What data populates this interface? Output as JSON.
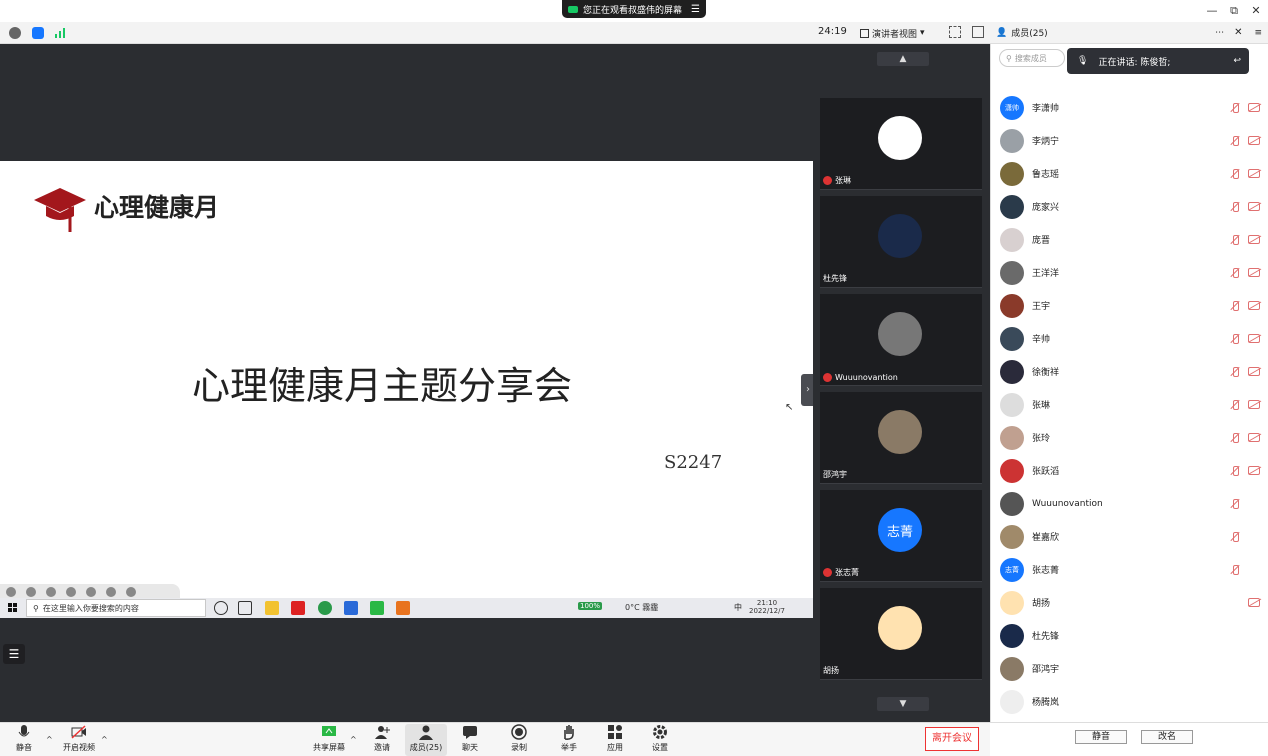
{
  "share_banner": {
    "text": "您正在观看叔盛伟的屏幕",
    "menu_icon": "menu-icon"
  },
  "window": {
    "min": "—",
    "restore": "⧉",
    "close": "✕"
  },
  "toolbar": {
    "timer": "24:19",
    "view_mode": "演讲者视图"
  },
  "slide": {
    "brand": "心理健康月",
    "title": "心理健康月主题分享会",
    "code": "S2247"
  },
  "taskbar": {
    "search_placeholder": "在这里输入你要搜索的内容",
    "battery": "100%",
    "weather": "0°C 霧霾",
    "ime": "中",
    "time": "21:10",
    "date": "2022/12/7"
  },
  "video_tiles": [
    {
      "name": "张琳",
      "avatar_bg": "#ffffff",
      "avatar_text": ""
    },
    {
      "name": "杜先锋",
      "avatar_bg": "#1a2a4a",
      "avatar_text": ""
    },
    {
      "name": "Wuuunovantion",
      "avatar_bg": "#777777",
      "avatar_text": ""
    },
    {
      "name": "邵鸿宇",
      "avatar_bg": "#8a7a66",
      "avatar_text": ""
    },
    {
      "name": "张志菁",
      "avatar_bg": "#1677ff",
      "avatar_text": "志菁"
    },
    {
      "name": "胡扬",
      "avatar_bg": "#ffe2b0",
      "avatar_text": ""
    }
  ],
  "panel": {
    "title": "成员(25)",
    "search_placeholder": "搜索成员",
    "talking": "正在讲话: 陈俊哲;",
    "participants": [
      {
        "name": "李潇帅",
        "bg": "#1677ff",
        "text": "潇帅",
        "mic_off": true,
        "cam_off": true
      },
      {
        "name": "李炳宁",
        "bg": "#9aa0a6",
        "text": "",
        "mic_off": true,
        "cam_off": true
      },
      {
        "name": "鲁志瑶",
        "bg": "#7a6a3a",
        "text": "",
        "mic_off": true,
        "cam_off": true
      },
      {
        "name": "庞家兴",
        "bg": "#2a3a4a",
        "text": "",
        "mic_off": true,
        "cam_off": true
      },
      {
        "name": "庞晋",
        "bg": "#d8d0d0",
        "text": "",
        "mic_off": true,
        "cam_off": true
      },
      {
        "name": "王洋洋",
        "bg": "#6a6a6a",
        "text": "",
        "mic_off": true,
        "cam_off": true
      },
      {
        "name": "王宇",
        "bg": "#8a3a2a",
        "text": "",
        "mic_off": true,
        "cam_off": true
      },
      {
        "name": "辛帅",
        "bg": "#3a4a5a",
        "text": "",
        "mic_off": true,
        "cam_off": true
      },
      {
        "name": "徐衡祥",
        "bg": "#2a2a3a",
        "text": "",
        "mic_off": true,
        "cam_off": true
      },
      {
        "name": "张琳",
        "bg": "#dddddd",
        "text": "",
        "mic_off": true,
        "cam_off": true
      },
      {
        "name": "张玲",
        "bg": "#c0a090",
        "text": "",
        "mic_off": true,
        "cam_off": true
      },
      {
        "name": "张跃滔",
        "bg": "#cc3333",
        "text": "",
        "mic_off": true,
        "cam_off": true
      },
      {
        "name": "Wuuunovantion",
        "bg": "#555555",
        "text": "",
        "mic_off": true,
        "cam_off": false
      },
      {
        "name": "崔嘉欣",
        "bg": "#a08a6a",
        "text": "",
        "mic_off": true,
        "cam_off": false
      },
      {
        "name": "张志菁",
        "bg": "#1677ff",
        "text": "志菁",
        "mic_off": true,
        "cam_off": false
      },
      {
        "name": "胡扬",
        "bg": "#ffe2b0",
        "text": "",
        "mic_off": false,
        "cam_off": true
      },
      {
        "name": "杜先锋",
        "bg": "#1a2a4a",
        "text": "",
        "mic_off": false,
        "cam_off": false
      },
      {
        "name": "邵鸿宇",
        "bg": "#8a7a66",
        "text": "",
        "mic_off": false,
        "cam_off": false
      },
      {
        "name": "杨腾岚",
        "bg": "#eeeeee",
        "text": "",
        "mic_off": false,
        "cam_off": false
      }
    ],
    "mute_all": "静音",
    "rename": "改名"
  },
  "controls": {
    "mute": "静音",
    "video": "开启视频",
    "share": "共享屏幕",
    "invite": "邀请",
    "members": "成员(25)",
    "chat": "聊天",
    "record": "录制",
    "hand": "举手",
    "apps": "应用",
    "settings": "设置",
    "leave": "离开会议"
  }
}
